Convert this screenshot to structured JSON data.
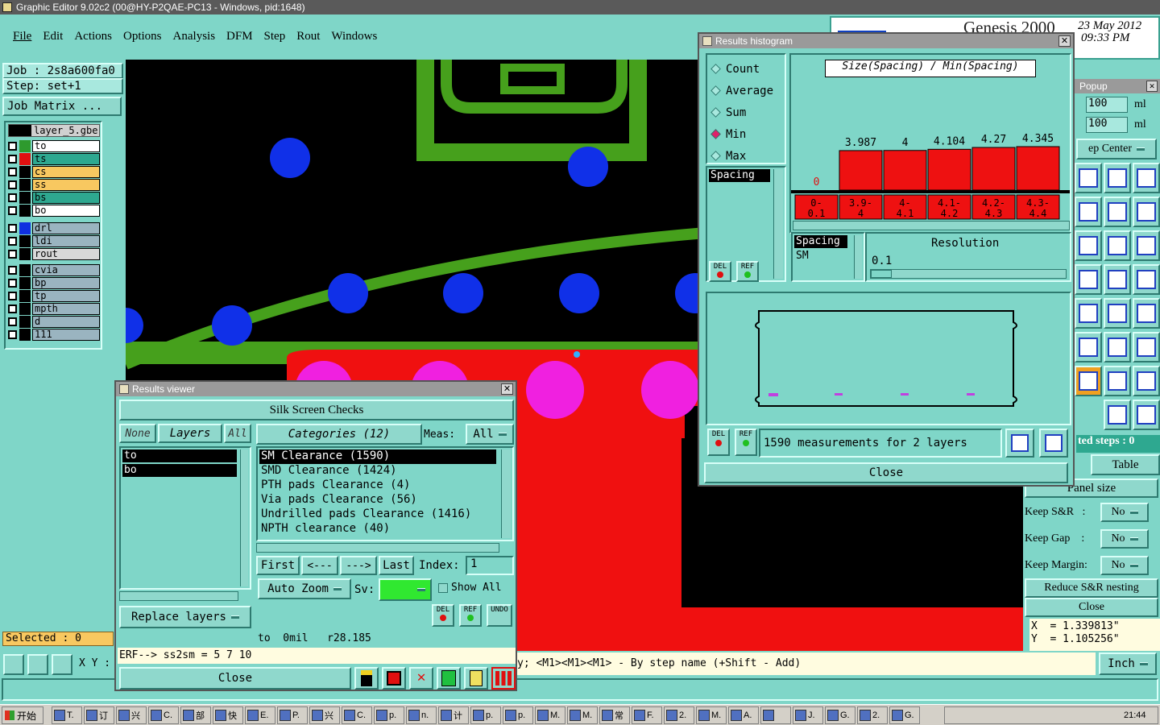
{
  "app": {
    "title": "Graphic Editor 9.02c2 (00@HY-P2QAE-PC13 - Windows, pid:1648)",
    "brand": "Genesis 2000",
    "date": "23 May 2012",
    "time": "09:33 PM"
  },
  "menu": [
    "File",
    "Edit",
    "Actions",
    "Options",
    "Analysis",
    "DFM",
    "Step",
    "Rout",
    "Windows"
  ],
  "left": {
    "job": "Job : 2s8a600fa0",
    "step": "Step: set+1",
    "job_matrix": "Job Matrix ...",
    "layer_select": "layer_5.gbe",
    "layers": [
      {
        "name": "to",
        "color": "#2e9a2e",
        "bg": "#ffffff"
      },
      {
        "name": "ts",
        "color": "#e01010",
        "bg": "#2ea890"
      },
      {
        "name": "cs",
        "color": "#000000",
        "bg": "#f8c860"
      },
      {
        "name": "ss",
        "color": "#000000",
        "bg": "#f8c860"
      },
      {
        "name": "bs",
        "color": "#000000",
        "bg": "#2ea890"
      },
      {
        "name": "bo",
        "color": "#000000",
        "bg": "#ffffff"
      }
    ],
    "layers2": [
      {
        "name": "drl",
        "color": "#1030e0",
        "bg": "#9ab4c0"
      },
      {
        "name": "ldi",
        "color": "#000000",
        "bg": "#9ab4c0"
      },
      {
        "name": "rout",
        "color": "#000000",
        "bg": "#d8d8d8"
      }
    ],
    "layers3": [
      {
        "name": "cvia",
        "color": "#000000",
        "bg": "#9ab4c0"
      },
      {
        "name": "bp",
        "color": "#000000",
        "bg": "#9ab4c0"
      },
      {
        "name": "tp",
        "color": "#000000",
        "bg": "#9ab4c0"
      },
      {
        "name": "mpth",
        "color": "#000000",
        "bg": "#9ab4c0"
      },
      {
        "name": "d",
        "color": "#000000",
        "bg": "#9ab4c0"
      },
      {
        "name": "111",
        "color": "#000000",
        "bg": "#9ab4c0"
      }
    ],
    "selected": "Selected : 0",
    "xy_label": "X Y :"
  },
  "status_bar": {
    "hint": "y; <M1><M1><M1> - By step name (+Shift - Add)",
    "units": "Inch"
  },
  "results_viewer": {
    "title": "Results viewer",
    "header": "Silk Screen Checks",
    "none": "None",
    "layers": "Layers",
    "all": "All",
    "categories": "Categories (12)",
    "meas_label": "Meas:",
    "meas_value": "All",
    "layer_items": [
      "to",
      "bo"
    ],
    "category_items": [
      "SM Clearance (1590)",
      "SMD Clearance (1424)",
      "PTH pads Clearance (4)",
      "Via pads Clearance (56)",
      "Undrilled pads Clearance (1416)",
      "NPTH clearance (40)"
    ],
    "first": "First",
    "prev": "<---",
    "next": "--->",
    "last": "Last",
    "index_label": "Index:",
    "index_value": "1",
    "auto_zoom": "Auto Zoom",
    "sv_label": "Sv:",
    "show_all": "Show All",
    "replace_layers": "Replace layers",
    "del": "DEL",
    "ref": "REF",
    "undo": "UNDO",
    "info": "to  0mil   r28.185",
    "erf": "ERF--> ss2sm = 5 7 10",
    "close": "Close"
  },
  "histogram": {
    "title": "Results histogram",
    "modes": [
      "Count",
      "Average",
      "Sum",
      "Min",
      "Max"
    ],
    "selected_mode": "Min",
    "list_item": "Spacing",
    "chart_title": "Size(Spacing) / Min(Spacing)",
    "spacing_label": "Spacing",
    "sm_label": "SM",
    "resolution_label": "Resolution",
    "resolution_value": "0.1",
    "del": "DEL",
    "ref": "REF",
    "summary": "1590 measurements for 2 layers",
    "close": "Close"
  },
  "chart_data": {
    "type": "bar",
    "title": "Size(Spacing) / Min(Spacing)",
    "categories": [
      "0-0.1",
      "3.9-4",
      "4-4.1",
      "4.1-4.2",
      "4.2-4.3",
      "4.3-4.4"
    ],
    "values": [
      0,
      3.987,
      4,
      4.104,
      4.27,
      4.345
    ],
    "value_labels": [
      "0",
      "3.987",
      "4",
      "4.104",
      "4.27",
      "4.345"
    ],
    "category_labels": [
      [
        "0-",
        "0.1"
      ],
      [
        "3.9-",
        "4"
      ],
      [
        "4-",
        "4.1"
      ],
      [
        "4.1-",
        "4.2"
      ],
      [
        "4.2-",
        "4.3"
      ],
      [
        "4.3-",
        "4.4"
      ]
    ],
    "ylim": [
      0,
      4.345
    ],
    "bar_color": "#ee1111"
  },
  "popup": {
    "title": "Popup",
    "field1": "100",
    "field2": "100",
    "unit": "ml",
    "step_center": "ep Center",
    "nested_steps": "ted steps : 0",
    "table": "Table",
    "panel_size": "Panel size",
    "keep_sr_label": "Keep S&R   :",
    "keep_sr": "No",
    "keep_gap_label": "Keep Gap    :",
    "keep_gap": "No",
    "keep_margin_label": "Keep Margin:",
    "keep_margin": "No",
    "reduce": "Reduce S&R nesting",
    "close": "Close",
    "x": "X  = 1.339813\"",
    "y": "Y  = 1.105256\""
  },
  "taskbar": {
    "start": "开始",
    "items": [
      "T.",
      "订",
      "兴",
      "C.",
      "部",
      "快",
      "E.",
      "P.",
      "兴",
      "C.",
      "p.",
      "n.",
      "计",
      "p.",
      "p.",
      "M.",
      "M.",
      "常",
      "F.",
      "2.",
      "M.",
      "A.",
      "",
      "J.",
      "G.",
      "2.",
      "G."
    ],
    "clock": "21:44"
  }
}
